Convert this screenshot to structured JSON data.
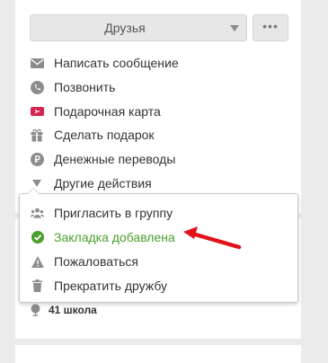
{
  "header": {
    "friends_label": "Друзья",
    "more_label": "•••"
  },
  "actions": [
    {
      "label": "Написать сообщение",
      "icon": "envelope-icon"
    },
    {
      "label": "Позвонить",
      "icon": "phone-icon"
    },
    {
      "label": "Подарочная карта",
      "icon": "gift-card-icon"
    },
    {
      "label": "Сделать подарок",
      "icon": "gift-icon"
    },
    {
      "label": "Денежные переводы",
      "icon": "ruble-icon"
    },
    {
      "label": "Другие действия",
      "icon": "triangle-down-icon"
    }
  ],
  "menu": {
    "items": [
      {
        "label": "Пригласить в группу",
        "icon": "group-icon"
      },
      {
        "label": "Закладка добавлена",
        "icon": "check-circle-icon",
        "state": "success"
      },
      {
        "label": "Пожаловаться",
        "icon": "warning-icon"
      },
      {
        "label": "Прекратить дружбу",
        "icon": "trash-icon"
      }
    ]
  },
  "profile": {
    "school": "41 школа"
  },
  "colors": {
    "success": "#4aa02c",
    "annotation_arrow": "#e3131a",
    "icon_gray": "#8c8c8c",
    "gift_card": "#d6224f"
  }
}
